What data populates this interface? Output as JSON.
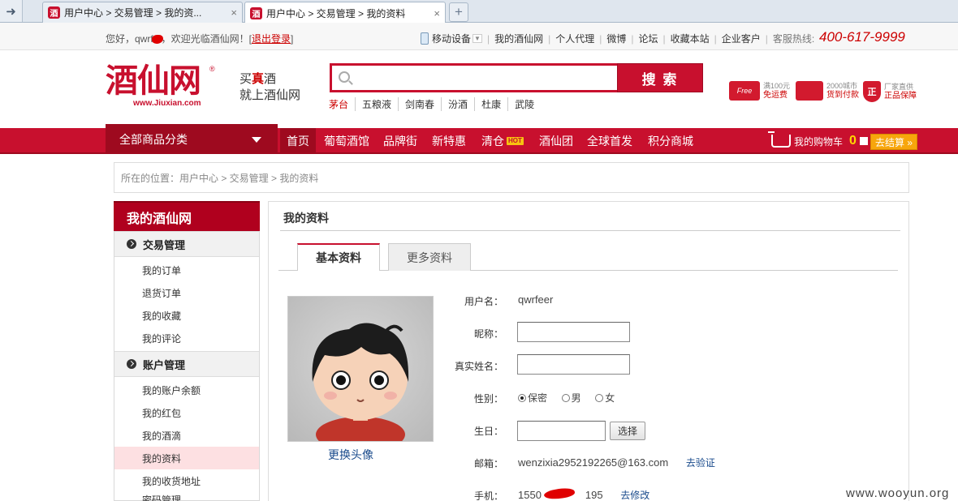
{
  "browser": {
    "tabs": [
      {
        "title": "用户中心 > 交易管理 > 我的资..."
      },
      {
        "title": "用户中心 > 交易管理 > 我的资料"
      }
    ],
    "new_tab_label": "+",
    "close_label": "×"
  },
  "topbar": {
    "greeting_prefix": "您好，qwrf",
    "greeting_suffix": "，欢迎光临酒仙网！[",
    "logout": "退出登录",
    "greeting_end": "]",
    "links": [
      "移动设备",
      "我的酒仙网",
      "个人代理",
      "微博",
      "论坛",
      "收藏本站",
      "企业客户",
      "客服热线:"
    ],
    "hotline": "400-617-9999"
  },
  "header": {
    "logo_cn": "酒仙网",
    "logo_en": "www.Jiuxian.com",
    "logo_reg": "®",
    "slogan_line1_a": "买",
    "slogan_line1_b": "真",
    "slogan_line1_c": "酒",
    "slogan_line2": "就上酒仙网",
    "search_placeholder": "",
    "search_button": "搜 索",
    "hot_words": [
      "茅台",
      "五粮液",
      "剑南春",
      "汾酒",
      "杜康",
      "武陵"
    ],
    "services": [
      {
        "icon": "Free",
        "small": "满100元",
        "main": "免运费"
      },
      {
        "icon": "",
        "small": "2000城市",
        "main": "货到付款"
      },
      {
        "icon": "正",
        "small": "厂家直供",
        "main": "正品保障"
      }
    ]
  },
  "nav": {
    "all_categories": "全部商品分类",
    "items": [
      "首页",
      "葡萄酒馆",
      "品牌街",
      "新特惠",
      "清仓",
      "酒仙团",
      "全球首发",
      "积分商城"
    ],
    "hot_badge": "HOT",
    "cart_label": "我的购物车",
    "cart_count": "0",
    "checkout": "去结算 »"
  },
  "breadcrumb": "所在的位置：用户中心 > 交易管理 > 我的资料",
  "sidebar": {
    "title": "我的酒仙网",
    "sections": [
      {
        "label": "交易管理",
        "items": [
          "我的订单",
          "退货订单",
          "我的收藏",
          "我的评论"
        ]
      },
      {
        "label": "账户管理",
        "items": [
          "我的账户余额",
          "我的红包",
          "我的酒滴",
          "我的资料",
          "我的收货地址",
          "密码管理"
        ]
      }
    ],
    "active_item": "我的资料"
  },
  "main": {
    "title": "我的资料",
    "tabs": [
      "基本资料",
      "更多资料"
    ],
    "change_avatar": "更换头像",
    "fields": {
      "username_label": "用户名：",
      "username_value": "qwrfeer",
      "nickname_label": "昵称：",
      "nickname_value": "",
      "realname_label": "真实姓名：",
      "realname_value": "",
      "gender_label": "性别：",
      "gender_options": [
        "保密",
        "男",
        "女"
      ],
      "gender_selected": "保密",
      "birthday_label": "生日：",
      "birthday_value": "",
      "pick_button": "选择",
      "email_label": "邮箱：",
      "email_value": "wenzixia2952192265@163.com",
      "email_action": "去验证",
      "mobile_label": "手机：",
      "mobile_prefix": "1550",
      "mobile_suffix": "195",
      "mobile_action": "去修改"
    }
  },
  "watermark": "www.wooyun.org"
}
